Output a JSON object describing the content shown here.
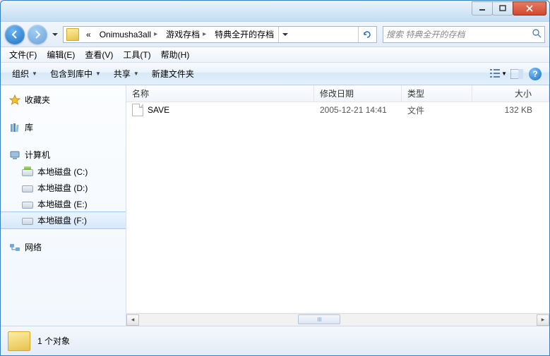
{
  "breadcrumb": {
    "prefix": "«",
    "items": [
      "Onimusha3all",
      "游戏存档",
      "特典全开的存档"
    ]
  },
  "search": {
    "placeholder": "搜索 特典全开的存档"
  },
  "menubar": {
    "file": "文件(F)",
    "edit": "编辑(E)",
    "view": "查看(V)",
    "tools": "工具(T)",
    "help": "帮助(H)"
  },
  "toolbar": {
    "organize": "组织",
    "include": "包含到库中",
    "share": "共享",
    "newfolder": "新建文件夹"
  },
  "sidebar": {
    "favorites": "收藏夹",
    "libraries": "库",
    "computer": "计算机",
    "drives": [
      {
        "label": "本地磁盘 (C:)"
      },
      {
        "label": "本地磁盘 (D:)"
      },
      {
        "label": "本地磁盘 (E:)"
      },
      {
        "label": "本地磁盘 (F:)"
      }
    ],
    "network": "网络"
  },
  "columns": {
    "name": "名称",
    "date": "修改日期",
    "type": "类型",
    "size": "大小"
  },
  "files": [
    {
      "name": "SAVE",
      "date": "2005-12-21 14:41",
      "type": "文件",
      "size": "132 KB"
    }
  ],
  "status": {
    "count": "1 个对象"
  }
}
